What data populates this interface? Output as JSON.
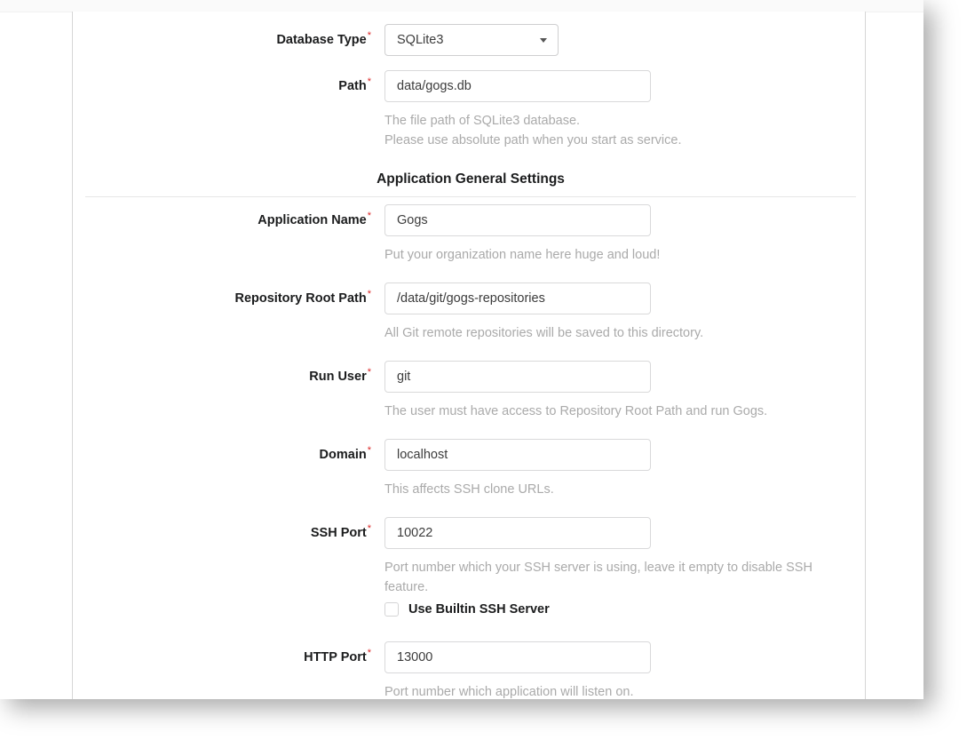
{
  "form": {
    "fields": [
      {
        "key": "database_type",
        "label": "Database Type",
        "required_marker": "*",
        "control": "select",
        "value": "SQLite3",
        "help": ""
      },
      {
        "key": "path",
        "label": "Path",
        "required_marker": "*",
        "control": "text",
        "value": "data/gogs.db",
        "help": "The file path of SQLite3 database.\nPlease use absolute path when you start as service."
      },
      {
        "key": "application_name",
        "label": "Application Name",
        "required_marker": "*",
        "control": "text",
        "value": "Gogs",
        "help": "Put your organization name here huge and loud!"
      },
      {
        "key": "repository_root_path",
        "label": "Repository Root Path",
        "required_marker": "*",
        "control": "text",
        "value": "/data/git/gogs-repositories",
        "help": "All Git remote repositories will be saved to this directory."
      },
      {
        "key": "run_user",
        "label": "Run User",
        "required_marker": "*",
        "control": "text",
        "value": "git",
        "help": "The user must have access to Repository Root Path and run Gogs."
      },
      {
        "key": "domain",
        "label": "Domain",
        "required_marker": "*",
        "control": "text",
        "value": "localhost",
        "help": "This affects SSH clone URLs."
      },
      {
        "key": "ssh_port",
        "label": "SSH Port",
        "required_marker": "*",
        "control": "text",
        "value": "10022",
        "help": "Port number which your SSH server is using, leave it empty to disable SSH feature."
      },
      {
        "key": "http_port",
        "label": "HTTP Port",
        "required_marker": "*",
        "control": "text",
        "value": "13000",
        "help": "Port number which application will listen on."
      }
    ],
    "section_header": {
      "title": "Application General Settings"
    },
    "checkbox": {
      "label": "Use Builtin SSH Server",
      "checked": false
    }
  },
  "icons": {
    "dropdown": "chevron-down-icon"
  },
  "colors": {
    "required_star": "#db2828",
    "label_text": "#1b1c1d",
    "input_text": "#3c3c3c",
    "help_text": "#aaaaaa",
    "input_border": "#d9d9da",
    "rule": "#e6e6e6"
  }
}
